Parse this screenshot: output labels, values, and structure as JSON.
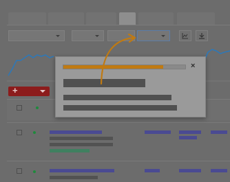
{
  "colors": {
    "overlay_background": "#6c6c6c",
    "progress_fill": "#c07a12",
    "add_button": "#8c1c1c",
    "chart_line": "#2d78b8",
    "arrow": "#c07a12",
    "link_bars": "#4a4a92",
    "status_dot": "#1e8a3c"
  },
  "icons": {
    "add": "plus-icon",
    "dropdown": "chevron-down-icon",
    "chart": "chart-icon",
    "download": "download-icon",
    "close": "close-icon"
  },
  "add_button": {
    "label": "+"
  },
  "dialog": {
    "progress_fraction": 0.82,
    "close_label": "×"
  }
}
